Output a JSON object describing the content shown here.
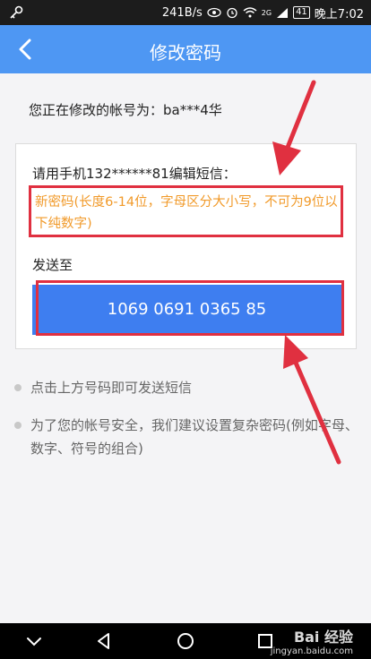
{
  "status_bar": {
    "network_speed": "241B/s",
    "network_badge": "2G",
    "battery_level": "41",
    "clock": "晚上7:02"
  },
  "header": {
    "title": "修改密码",
    "back_icon": "chevron-left-icon"
  },
  "account": {
    "label": "您正在修改的帐号为：",
    "value": "ba***4华"
  },
  "card": {
    "sms_instruction": "请用手机132******81编辑短信：",
    "password_rule": "新密码(长度6-14位，字母区分大小写，不可为9位以下纯数字)",
    "send_to_label": "发送至",
    "target_number": "1069 0691 0365 85"
  },
  "tips": [
    "点击上方号码即可发送短信",
    "为了您的帐号安全，我们建议设置复杂密码(例如字母、数字、符号的组合)"
  ],
  "watermark": {
    "brand": "Bai 经验",
    "url": "jingyan.baidu.com"
  },
  "colors": {
    "appbar": "#4e97f3",
    "button": "#3e7ef0",
    "annotation_red": "#e03040",
    "rule_text_orange": "#f19a2a"
  }
}
